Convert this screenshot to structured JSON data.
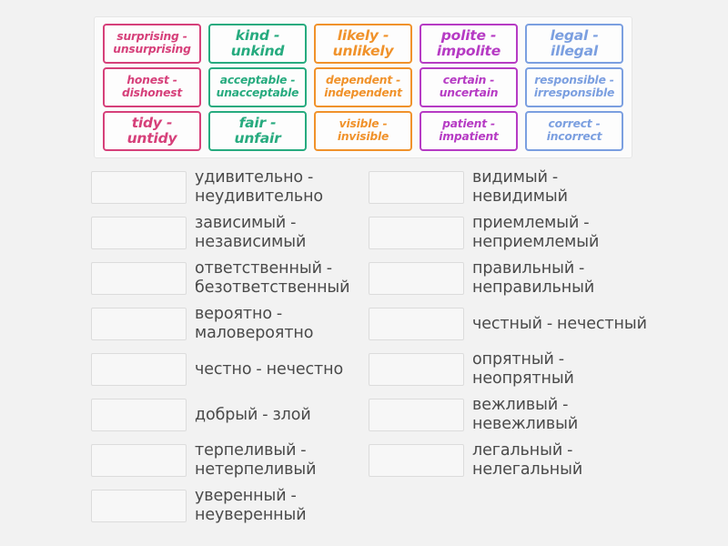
{
  "activity": {
    "type": "match-up",
    "colors": {
      "pink": "#d6407a",
      "green": "#27ab7f",
      "orange": "#f0922b",
      "purple": "#b63bc4",
      "blue": "#7b9fe0",
      "answer_text": "#4a4a4a",
      "background": "#f2f2f2",
      "tray_background": "#fbfbfb",
      "dropzone_background": "#f7f7f7",
      "dropzone_border": "#dcdcdc"
    }
  },
  "cards": {
    "rows": [
      [
        {
          "label": "surprising - unsurprising",
          "color": "pink",
          "lines": 2
        },
        {
          "label": "kind - unkind",
          "color": "green",
          "lines": 1
        },
        {
          "label": "likely - unlikely",
          "color": "orange",
          "lines": 1
        },
        {
          "label": "polite - impolite",
          "color": "purple",
          "lines": 1
        },
        {
          "label": "legal - illegal",
          "color": "blue",
          "lines": 1
        }
      ],
      [
        {
          "label": "honest - dishonest",
          "color": "pink",
          "lines": 2
        },
        {
          "label": "acceptable - unacceptable",
          "color": "green",
          "lines": 2
        },
        {
          "label": "dependent - independent",
          "color": "orange",
          "lines": 2
        },
        {
          "label": "certain - uncertain",
          "color": "purple",
          "lines": 2
        },
        {
          "label": "responsible - irresponsible",
          "color": "blue",
          "lines": 2
        }
      ],
      [
        {
          "label": "tidy - untidy",
          "color": "pink",
          "lines": 1
        },
        {
          "label": "fair - unfair",
          "color": "green",
          "lines": 1
        },
        {
          "label": "visible - invisible",
          "color": "orange",
          "lines": 2
        },
        {
          "label": "patient - impatient",
          "color": "purple",
          "lines": 2
        },
        {
          "label": "correct - incorrect",
          "color": "blue",
          "lines": 2
        }
      ]
    ]
  },
  "answers": {
    "left_column": [
      {
        "text": "удивительно - неудивительно",
        "dropped": ""
      },
      {
        "text": "зависимый - независимый",
        "dropped": ""
      },
      {
        "text": "ответственный - безответственный",
        "dropped": ""
      },
      {
        "text": "вероятно - маловероятно",
        "dropped": ""
      },
      {
        "text": "честно - нечестно",
        "dropped": ""
      },
      {
        "text": "добрый - злой",
        "dropped": ""
      },
      {
        "text": "терпеливый - нетерпеливый",
        "dropped": ""
      },
      {
        "text": "уверенный - неуверенный",
        "dropped": ""
      }
    ],
    "right_column": [
      {
        "text": "видимый - невидимый",
        "dropped": ""
      },
      {
        "text": "приемлемый - неприемлемый",
        "dropped": ""
      },
      {
        "text": "правильный - неправильный",
        "dropped": ""
      },
      {
        "text": "честный - нечестный",
        "dropped": ""
      },
      {
        "text": "опрятный - неопрятный",
        "dropped": ""
      },
      {
        "text": "вежливый - невежливый",
        "dropped": ""
      },
      {
        "text": "легальный - нелегальный",
        "dropped": ""
      }
    ]
  }
}
